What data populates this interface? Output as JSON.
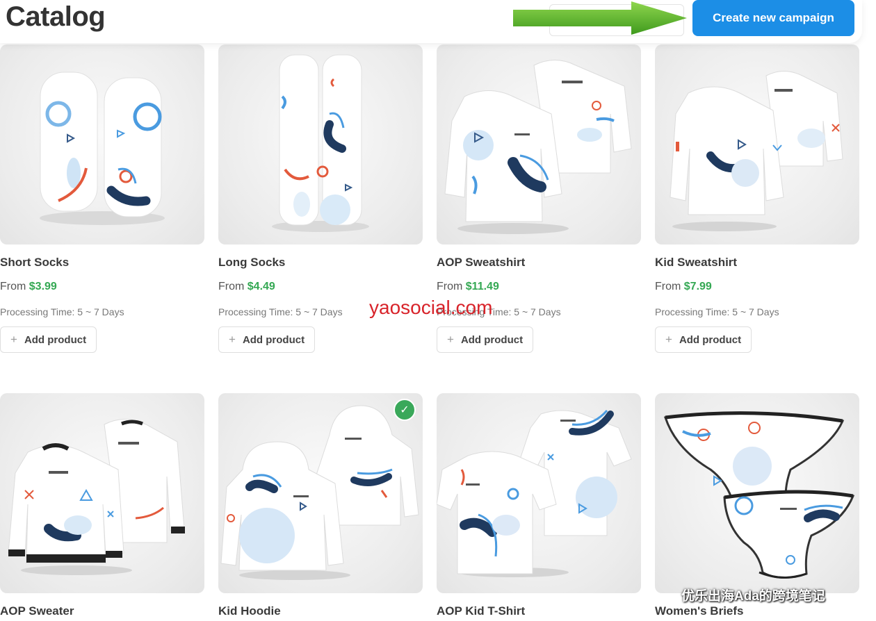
{
  "header": {
    "title": "Catalog",
    "create_button": "Create new campaign"
  },
  "products": [
    {
      "name": "Short Socks",
      "price_prefix": "From",
      "price": "$3.99",
      "processing": "Processing Time: 5 ~ 7 Days",
      "add_label": "Add product"
    },
    {
      "name": "Long Socks",
      "price_prefix": "From",
      "price": "$4.49",
      "processing": "Processing Time: 5 ~ 7 Days",
      "add_label": "Add product"
    },
    {
      "name": "AOP Sweatshirt",
      "price_prefix": "From",
      "price": "$11.49",
      "processing": "Processing Time: 5 ~ 7 Days",
      "add_label": "Add product"
    },
    {
      "name": "Kid Sweatshirt",
      "price_prefix": "From",
      "price": "$7.99",
      "processing": "Processing Time: 5 ~ 7 Days",
      "add_label": "Add product"
    },
    {
      "name": "AOP Sweater"
    },
    {
      "name": "Kid Hoodie",
      "selected": true
    },
    {
      "name": "AOP Kid T-Shirt"
    },
    {
      "name": "Women's Briefs"
    }
  ],
  "icons": {
    "plus": "plus-icon",
    "check": "check-icon",
    "arrow": "arrow-right-icon"
  },
  "colors": {
    "primary": "#1c8ee6",
    "price": "#34a853",
    "check": "#3aa85a",
    "arrow": "#5cb82e"
  },
  "watermarks": {
    "center": "yaosocial.com",
    "corner": "优乐出海Ada的跨境笔记"
  }
}
